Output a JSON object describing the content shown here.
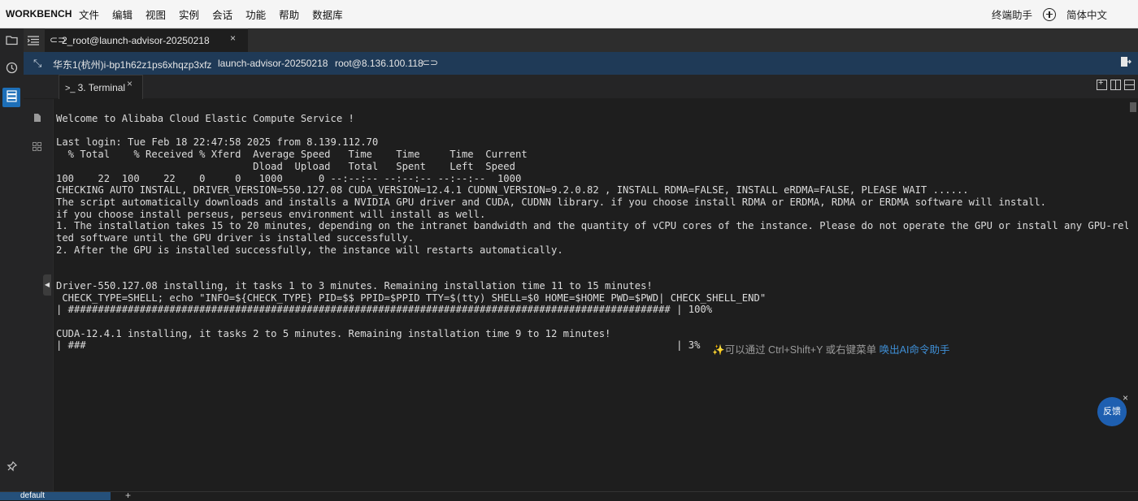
{
  "menubar": {
    "brand": "WORKBENCH",
    "items": [
      "文件",
      "编辑",
      "视图",
      "实例",
      "会话",
      "功能",
      "帮助",
      "数据库"
    ],
    "assistant": "终端助手",
    "language": "简体中文"
  },
  "session_tab": {
    "label": "2_root@launch-advisor-20250218",
    "close": "×"
  },
  "info": {
    "region": "华东1(杭州)i-bp1h62z1ps6xhqzp3xfz",
    "instance": "launch-advisor-20250218",
    "host": "root@8.136.100.118"
  },
  "terminal_tab": {
    "label": "3. Terminal",
    "close": "×"
  },
  "terminal": {
    "lines": [
      "Welcome to Alibaba Cloud Elastic Compute Service !",
      "",
      "Last login: Tue Feb 18 22:47:58 2025 from 8.139.112.70",
      "  % Total    % Received % Xferd  Average Speed   Time    Time     Time  Current",
      "                                 Dload  Upload   Total   Spent    Left  Speed",
      "100    22  100    22    0     0   1000      0 --:--:-- --:--:-- --:--:--  1000",
      "CHECKING AUTO INSTALL, DRIVER_VERSION=550.127.08 CUDA_VERSION=12.4.1 CUDNN_VERSION=9.2.0.82 , INSTALL RDMA=FALSE, INSTALL eRDMA=FALSE, PLEASE WAIT ......",
      "The script automatically downloads and installs a NVIDIA GPU driver and CUDA, CUDNN library. if you choose install RDMA or ERDMA, RDMA or ERDMA software will install.",
      "if you choose install perseus, perseus environment will install as well.",
      "1. The installation takes 15 to 20 minutes, depending on the intranet bandwidth and the quantity of vCPU cores of the instance. Please do not operate the GPU or install any GPU-rela",
      "ted software until the GPU driver is installed successfully.",
      "2. After the GPU is installed successfully, the instance will restarts automatically.",
      "",
      "",
      "Driver-550.127.08 installing, it tasks 1 to 3 minutes. Remaining installation time 11 to 15 minutes!",
      " CHECK_TYPE=SHELL; echo \"INFO=${CHECK_TYPE} PID=$$ PPID=$PPID TTY=$(tty) SHELL=$0 HOME=$HOME PWD=$PWD| CHECK_SHELL_END\"",
      "| ##################################################################################################### | 100%",
      "",
      "CUDA-12.4.1 installing, it tasks 2 to 5 minutes. Remaining installation time 9 to 12 minutes!",
      "| ###                                                                                                   | 3%"
    ],
    "hint_prefix": "✨可以通过 Ctrl+Shift+Y 或右键菜单 ",
    "hint_link": "唤出AI命令助手"
  },
  "feedback": {
    "label": "反馈",
    "close": "×"
  },
  "bottom": {
    "tab": "default",
    "add": "+"
  }
}
